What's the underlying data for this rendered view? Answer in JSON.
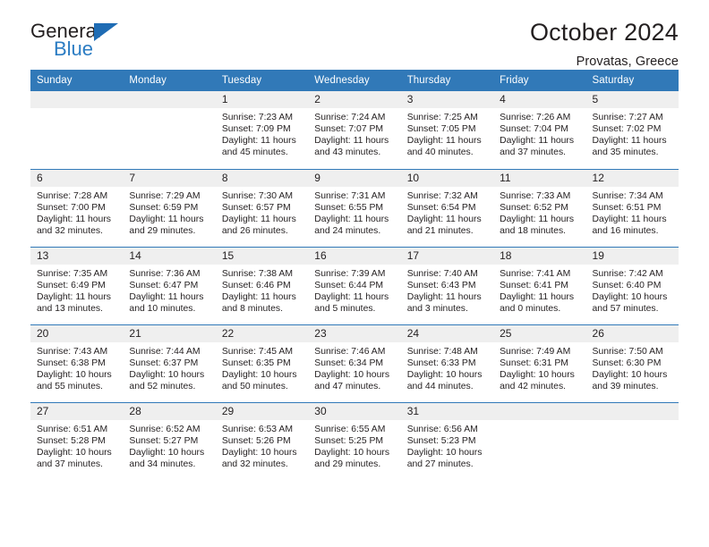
{
  "logo": {
    "primary_text": "General",
    "secondary_text": "Blue",
    "triangle_icon": "triangle-icon",
    "accent_color": "#2b7cc3"
  },
  "header": {
    "title": "October 2024",
    "subtitle": "Provatas, Greece"
  },
  "theme": {
    "header_blue": "#3179b8",
    "daynum_gray": "#efefef",
    "text": "#231f20"
  },
  "calendar": {
    "weekdays": [
      "Sunday",
      "Monday",
      "Tuesday",
      "Wednesday",
      "Thursday",
      "Friday",
      "Saturday"
    ],
    "weeks": [
      [
        {
          "day": "",
          "sunrise": "",
          "sunset": "",
          "daylight": ""
        },
        {
          "day": "",
          "sunrise": "",
          "sunset": "",
          "daylight": ""
        },
        {
          "day": "1",
          "sunrise": "Sunrise: 7:23 AM",
          "sunset": "Sunset: 7:09 PM",
          "daylight": "Daylight: 11 hours and 45 minutes."
        },
        {
          "day": "2",
          "sunrise": "Sunrise: 7:24 AM",
          "sunset": "Sunset: 7:07 PM",
          "daylight": "Daylight: 11 hours and 43 minutes."
        },
        {
          "day": "3",
          "sunrise": "Sunrise: 7:25 AM",
          "sunset": "Sunset: 7:05 PM",
          "daylight": "Daylight: 11 hours and 40 minutes."
        },
        {
          "day": "4",
          "sunrise": "Sunrise: 7:26 AM",
          "sunset": "Sunset: 7:04 PM",
          "daylight": "Daylight: 11 hours and 37 minutes."
        },
        {
          "day": "5",
          "sunrise": "Sunrise: 7:27 AM",
          "sunset": "Sunset: 7:02 PM",
          "daylight": "Daylight: 11 hours and 35 minutes."
        }
      ],
      [
        {
          "day": "6",
          "sunrise": "Sunrise: 7:28 AM",
          "sunset": "Sunset: 7:00 PM",
          "daylight": "Daylight: 11 hours and 32 minutes."
        },
        {
          "day": "7",
          "sunrise": "Sunrise: 7:29 AM",
          "sunset": "Sunset: 6:59 PM",
          "daylight": "Daylight: 11 hours and 29 minutes."
        },
        {
          "day": "8",
          "sunrise": "Sunrise: 7:30 AM",
          "sunset": "Sunset: 6:57 PM",
          "daylight": "Daylight: 11 hours and 26 minutes."
        },
        {
          "day": "9",
          "sunrise": "Sunrise: 7:31 AM",
          "sunset": "Sunset: 6:55 PM",
          "daylight": "Daylight: 11 hours and 24 minutes."
        },
        {
          "day": "10",
          "sunrise": "Sunrise: 7:32 AM",
          "sunset": "Sunset: 6:54 PM",
          "daylight": "Daylight: 11 hours and 21 minutes."
        },
        {
          "day": "11",
          "sunrise": "Sunrise: 7:33 AM",
          "sunset": "Sunset: 6:52 PM",
          "daylight": "Daylight: 11 hours and 18 minutes."
        },
        {
          "day": "12",
          "sunrise": "Sunrise: 7:34 AM",
          "sunset": "Sunset: 6:51 PM",
          "daylight": "Daylight: 11 hours and 16 minutes."
        }
      ],
      [
        {
          "day": "13",
          "sunrise": "Sunrise: 7:35 AM",
          "sunset": "Sunset: 6:49 PM",
          "daylight": "Daylight: 11 hours and 13 minutes."
        },
        {
          "day": "14",
          "sunrise": "Sunrise: 7:36 AM",
          "sunset": "Sunset: 6:47 PM",
          "daylight": "Daylight: 11 hours and 10 minutes."
        },
        {
          "day": "15",
          "sunrise": "Sunrise: 7:38 AM",
          "sunset": "Sunset: 6:46 PM",
          "daylight": "Daylight: 11 hours and 8 minutes."
        },
        {
          "day": "16",
          "sunrise": "Sunrise: 7:39 AM",
          "sunset": "Sunset: 6:44 PM",
          "daylight": "Daylight: 11 hours and 5 minutes."
        },
        {
          "day": "17",
          "sunrise": "Sunrise: 7:40 AM",
          "sunset": "Sunset: 6:43 PM",
          "daylight": "Daylight: 11 hours and 3 minutes."
        },
        {
          "day": "18",
          "sunrise": "Sunrise: 7:41 AM",
          "sunset": "Sunset: 6:41 PM",
          "daylight": "Daylight: 11 hours and 0 minutes."
        },
        {
          "day": "19",
          "sunrise": "Sunrise: 7:42 AM",
          "sunset": "Sunset: 6:40 PM",
          "daylight": "Daylight: 10 hours and 57 minutes."
        }
      ],
      [
        {
          "day": "20",
          "sunrise": "Sunrise: 7:43 AM",
          "sunset": "Sunset: 6:38 PM",
          "daylight": "Daylight: 10 hours and 55 minutes."
        },
        {
          "day": "21",
          "sunrise": "Sunrise: 7:44 AM",
          "sunset": "Sunset: 6:37 PM",
          "daylight": "Daylight: 10 hours and 52 minutes."
        },
        {
          "day": "22",
          "sunrise": "Sunrise: 7:45 AM",
          "sunset": "Sunset: 6:35 PM",
          "daylight": "Daylight: 10 hours and 50 minutes."
        },
        {
          "day": "23",
          "sunrise": "Sunrise: 7:46 AM",
          "sunset": "Sunset: 6:34 PM",
          "daylight": "Daylight: 10 hours and 47 minutes."
        },
        {
          "day": "24",
          "sunrise": "Sunrise: 7:48 AM",
          "sunset": "Sunset: 6:33 PM",
          "daylight": "Daylight: 10 hours and 44 minutes."
        },
        {
          "day": "25",
          "sunrise": "Sunrise: 7:49 AM",
          "sunset": "Sunset: 6:31 PM",
          "daylight": "Daylight: 10 hours and 42 minutes."
        },
        {
          "day": "26",
          "sunrise": "Sunrise: 7:50 AM",
          "sunset": "Sunset: 6:30 PM",
          "daylight": "Daylight: 10 hours and 39 minutes."
        }
      ],
      [
        {
          "day": "27",
          "sunrise": "Sunrise: 6:51 AM",
          "sunset": "Sunset: 5:28 PM",
          "daylight": "Daylight: 10 hours and 37 minutes."
        },
        {
          "day": "28",
          "sunrise": "Sunrise: 6:52 AM",
          "sunset": "Sunset: 5:27 PM",
          "daylight": "Daylight: 10 hours and 34 minutes."
        },
        {
          "day": "29",
          "sunrise": "Sunrise: 6:53 AM",
          "sunset": "Sunset: 5:26 PM",
          "daylight": "Daylight: 10 hours and 32 minutes."
        },
        {
          "day": "30",
          "sunrise": "Sunrise: 6:55 AM",
          "sunset": "Sunset: 5:25 PM",
          "daylight": "Daylight: 10 hours and 29 minutes."
        },
        {
          "day": "31",
          "sunrise": "Sunrise: 6:56 AM",
          "sunset": "Sunset: 5:23 PM",
          "daylight": "Daylight: 10 hours and 27 minutes."
        },
        {
          "day": "",
          "sunrise": "",
          "sunset": "",
          "daylight": ""
        },
        {
          "day": "",
          "sunrise": "",
          "sunset": "",
          "daylight": ""
        }
      ]
    ]
  }
}
